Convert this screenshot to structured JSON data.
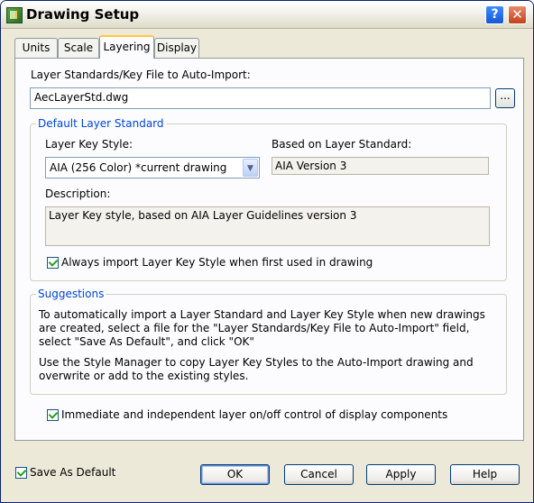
{
  "window": {
    "title": "Drawing Setup",
    "help_glyph": "?",
    "close_glyph": "✕"
  },
  "tabs": [
    "Units",
    "Scale",
    "Layering",
    "Display"
  ],
  "active_tab": "Layering",
  "layering": {
    "autoimport_label": "Layer Standards/Key File to Auto-Import:",
    "autoimport_value": "AecLayerStd.dwg",
    "browse_label": "...",
    "default_group": {
      "legend": "Default Layer Standard",
      "key_style_label": "Layer Key Style:",
      "key_style_value": "AIA (256 Color) *current drawing",
      "based_on_label": "Based on Layer Standard:",
      "based_on_value": "AIA Version 3",
      "description_label": "Description:",
      "description_value": "Layer Key style, based on AIA Layer Guidelines version 3",
      "always_import_label": "Always import Layer Key Style when first used in drawing",
      "always_import_checked": true
    },
    "suggestions": {
      "legend": "Suggestions",
      "para1": "To automatically import a Layer Standard and Layer Key Style when new drawings are created, select a file for the \"Layer Standards/Key File to Auto-Import\" field, select \"Save As Default\", and click \"OK\"",
      "para2": "Use the Style Manager to copy Layer Key Styles to the Auto-Import drawing and overwrite or add to the existing styles."
    },
    "immediate_label": "Immediate and independent layer on/off control of display components",
    "immediate_checked": true
  },
  "footer": {
    "save_default_label": "Save As Default",
    "save_default_checked": true,
    "ok_label": "OK",
    "cancel_label": "Cancel",
    "apply_label": "Apply",
    "help_label": "Help"
  },
  "colors": {
    "legend_blue": "#0046d5",
    "dialog_bg": "#ece9d8",
    "check_green": "#21a121"
  }
}
